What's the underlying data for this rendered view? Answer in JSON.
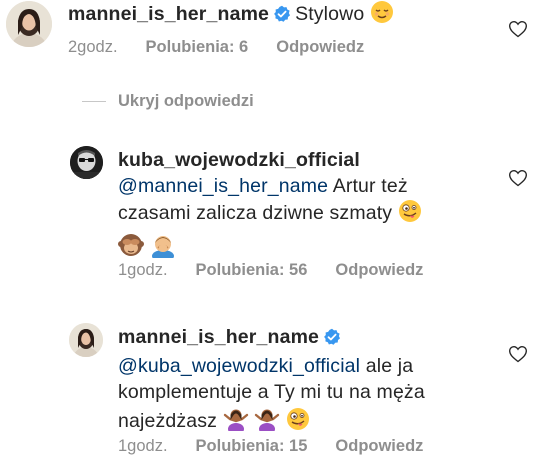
{
  "comments": [
    {
      "username": "mannei_is_her_name",
      "text": "Stylowo",
      "time": "2godz.",
      "likes": "Polubienia: 6",
      "reply": "Odpowiedz"
    },
    {
      "username": "kuba_wojewodzki_official",
      "mention": "@mannei_is_her_name",
      "text_line1": "Artur też",
      "text_line2": "czasami zalicza dziwne szmaty",
      "time": "1godz.",
      "likes": "Polubienia: 56",
      "reply": "Odpowiedz"
    },
    {
      "username": "mannei_is_her_name",
      "mention": "@kuba_wojewodzki_official",
      "text_line1": "ale ja",
      "text_line2": "komplementuje a Ty mi tu na męża",
      "text_line3": "najeżdżasz",
      "time": "1godz.",
      "likes": "Polubienia: 15",
      "reply": "Odpowiedz"
    }
  ],
  "toggle_label": "Ukryj odpowiedzi",
  "colors": {
    "text": "#262626",
    "secondary": "#8e8e8e",
    "mention": "#003569",
    "verified": "#3897f0"
  }
}
